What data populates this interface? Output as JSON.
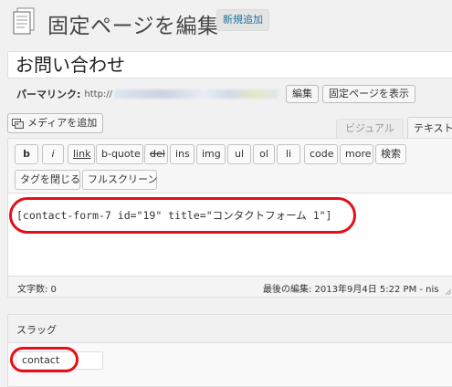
{
  "header": {
    "title": "固定ページを編集",
    "add_new_label": "新規追加"
  },
  "post": {
    "title": "お問い合わせ",
    "permalink_label": "パーマリンク:",
    "permalink_url_visible": "http://",
    "edit_slug_label": "編集",
    "view_page_label": "固定ページを表示"
  },
  "media": {
    "add_media_label": "メディアを追加"
  },
  "editor_tabs": {
    "visual": "ビジュアル",
    "text": "テキスト"
  },
  "quicktags": [
    "b",
    "i",
    "link",
    "b-quote",
    "del",
    "ins",
    "img",
    "ul",
    "ol",
    "li",
    "code",
    "more",
    "検索",
    "タグを閉じる",
    "フルスクリーン"
  ],
  "editor": {
    "content": "[contact-form-7 id=\"19\" title=\"コンタクトフォーム 1\"]",
    "word_count": "文字数: 0",
    "last_edited": "最後の編集: 2013年9月4日  5:22 PM - nis"
  },
  "slug_box": {
    "title": "スラッグ",
    "value": "contact"
  },
  "colors": {
    "highlight": "#e3101a",
    "link": "#21759b"
  }
}
